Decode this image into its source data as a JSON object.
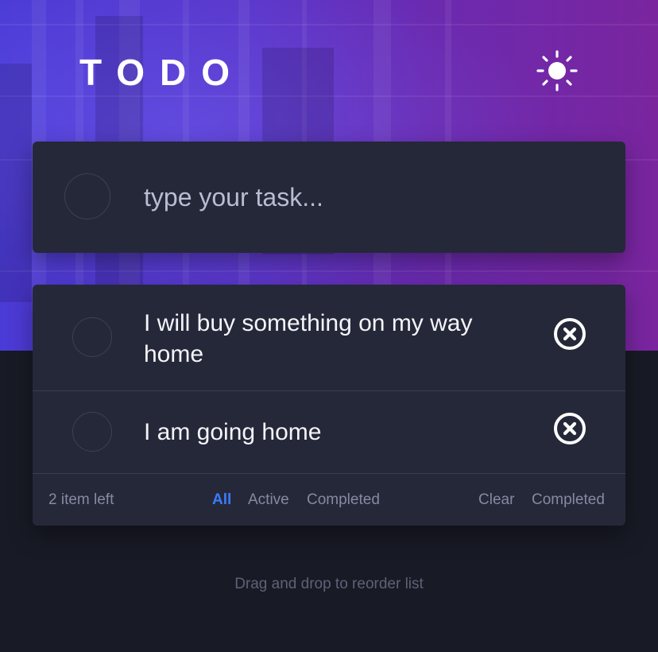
{
  "app": {
    "title": "TODO"
  },
  "theme_toggle": {
    "icon": "sun-icon"
  },
  "new_task": {
    "placeholder": "type your task...",
    "value": ""
  },
  "tasks": [
    {
      "text": "I will buy something on my way home",
      "completed": false
    },
    {
      "text": "I am going home",
      "completed": false
    }
  ],
  "footer": {
    "items_left": "2 item left",
    "filters": [
      "All",
      "Active",
      "Completed"
    ],
    "selected_filter": "All",
    "clear_label_1": "Clear",
    "clear_label_2": "Completed"
  },
  "hint": "Drag and drop to reorder list",
  "colors": {
    "accent": "#3a7bfd",
    "card": "#252838",
    "page_bg": "#181a25",
    "hero_start": "#4b3bd6",
    "hero_end": "#7a259e"
  }
}
